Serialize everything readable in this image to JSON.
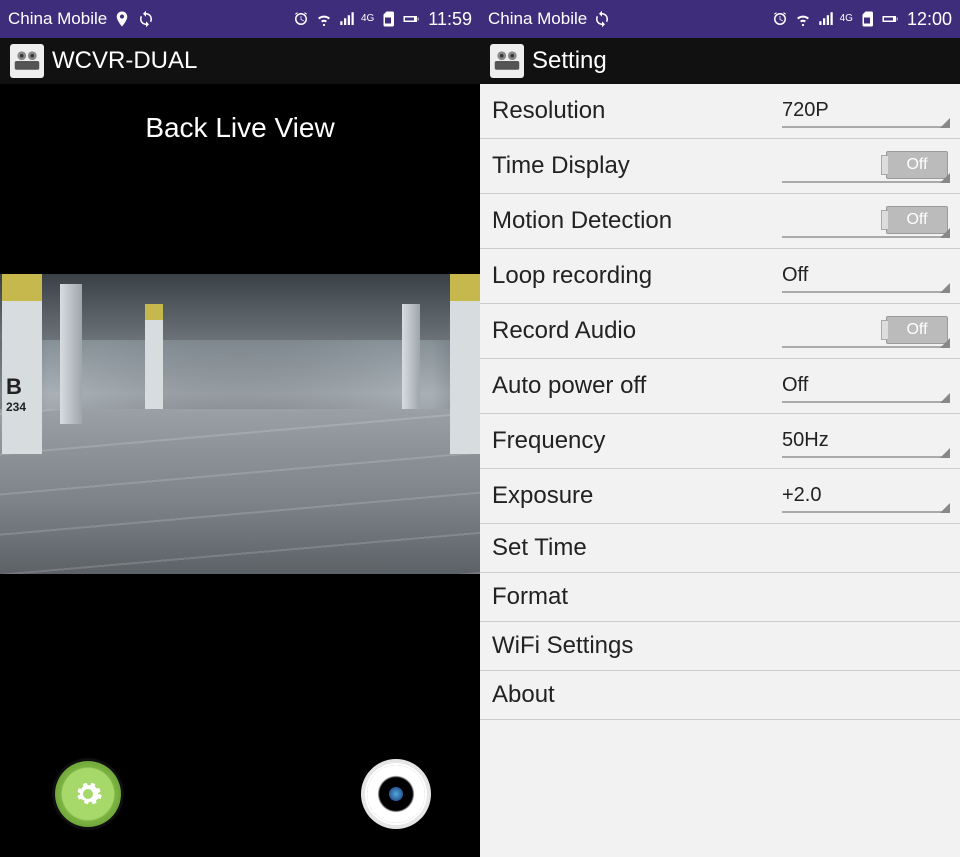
{
  "left": {
    "status": {
      "carrier": "China Mobile",
      "time": "11:59",
      "network": "4G"
    },
    "appTitle": "WCVR-DUAL",
    "viewTitle": "Back Live View",
    "signLetter": "B",
    "signNumber": "234",
    "settingsBtn": "settings",
    "captureBtn": "capture"
  },
  "right": {
    "status": {
      "carrier": "China Mobile",
      "time": "12:00",
      "network": "4G"
    },
    "appTitle": "Setting",
    "rows": {
      "resolution": {
        "label": "Resolution",
        "value": "720P"
      },
      "timeDisplay": {
        "label": "Time Display",
        "toggle": "Off"
      },
      "motionDetection": {
        "label": "Motion Detection",
        "toggle": "Off"
      },
      "loopRecording": {
        "label": "Loop recording",
        "value": "Off"
      },
      "recordAudio": {
        "label": "Record Audio",
        "toggle": "Off"
      },
      "autoPowerOff": {
        "label": "Auto power off",
        "value": "Off"
      },
      "frequency": {
        "label": "Frequency",
        "value": "50Hz"
      },
      "exposure": {
        "label": "Exposure",
        "value": "+2.0"
      },
      "setTime": {
        "label": "Set Time"
      },
      "format": {
        "label": "Format"
      },
      "wifiSettings": {
        "label": "WiFi Settings"
      },
      "about": {
        "label": "About"
      }
    }
  }
}
